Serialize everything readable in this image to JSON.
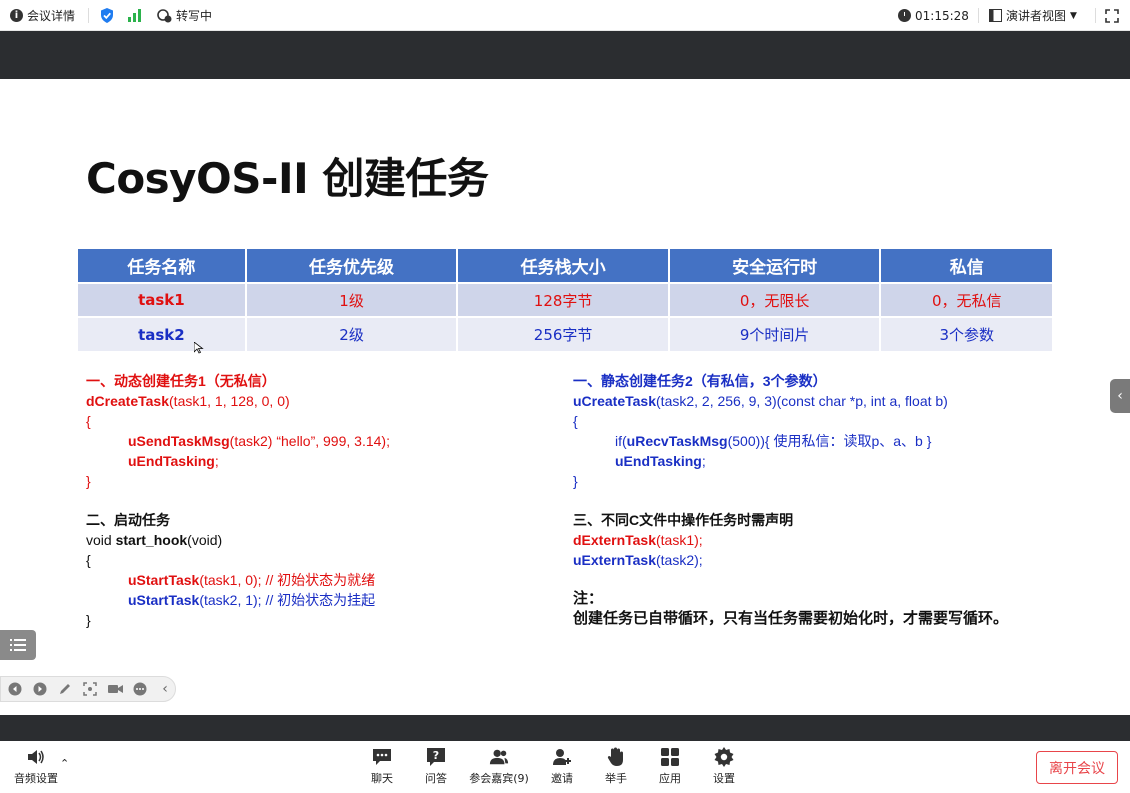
{
  "topbar": {
    "meeting_info": "会议详情",
    "transcribing": "转写中",
    "timer": "01:15:28",
    "view_mode": "演讲者视图"
  },
  "slide": {
    "title": "CosyOS-II 创建任务",
    "table": {
      "headers": [
        "任务名称",
        "任务优先级",
        "任务栈大小",
        "安全运行时",
        "私信"
      ],
      "rows": [
        [
          "task1",
          "1级",
          "128字节",
          "0，无限长",
          "0，无私信"
        ],
        [
          "task2",
          "2级",
          "256字节",
          "9个时间片",
          "3个参数"
        ]
      ]
    },
    "left_block1": {
      "heading": "一、动态创建任务1（无私信）",
      "call_fn": "dCreateTask",
      "call_args": "(task1, 1, 128, 0, 0)",
      "open": "{",
      "l1_fn": "uSendTaskMsg",
      "l1_rest": "(task2) “hello”, 999, 3.14);",
      "l2_fn": "uEndTasking",
      "l2_rest": ";",
      "close": "}"
    },
    "left_block2": {
      "heading": "二、启动任务",
      "sig_pre": "void ",
      "sig_fn": "start_hook",
      "sig_post": "(void)",
      "open": "{",
      "l1_fn": "uStartTask",
      "l1_rest": "(task1, 0); // 初始状态为就绪",
      "l2_fn": "uStartTask",
      "l2_rest": "(task2, 1); // 初始状态为挂起",
      "close": "}"
    },
    "right_block1": {
      "heading": "一、静态创建任务2（有私信，3个参数）",
      "call_fn": "uCreateTask",
      "call_args": "(task2, 2, 256, 9, 3)(const char *p, int a, float b)",
      "open": "{",
      "l1_pre": "if(",
      "l1_fn": "uRecvTaskMsg",
      "l1_rest": "(500)){ 使用私信：读取p、a、b }",
      "l2_fn": "uEndTasking",
      "l2_rest": ";",
      "close": "}"
    },
    "right_block2": {
      "heading": "三、不同C文件中操作任务时需声明",
      "l1_fn": "dExternTask",
      "l1_rest": "(task1);",
      "l2_fn": "uExternTask",
      "l2_rest": "(task2);"
    },
    "note": {
      "label": "注：",
      "text": "创建任务已自带循环，只有当任务需要初始化时，才需要写循环。"
    }
  },
  "bottombar": {
    "audio": "音频设置",
    "chat": "聊天",
    "qa": "问答",
    "participants": "参会嘉宾(9)",
    "invite": "邀请",
    "raise_hand": "举手",
    "apps": "应用",
    "settings": "设置",
    "leave": "离开会议"
  },
  "colors": {
    "table_header": "#4472c4",
    "row1_bg": "#cfd5ea",
    "row2_bg": "#e9ebf5",
    "red_text": "#e01010",
    "blue_text": "#1a2fc4",
    "leave_button": "#e8454a"
  }
}
